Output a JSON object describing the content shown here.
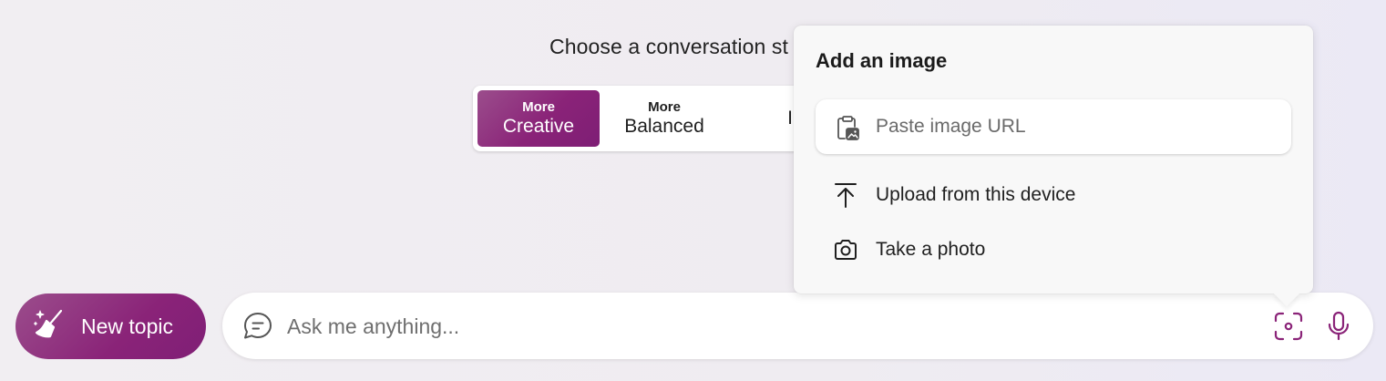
{
  "conversation_style": {
    "heading": "Choose a conversation st",
    "options": [
      {
        "top": "More",
        "main": "Creative",
        "active": true
      },
      {
        "top": "More",
        "main": "Balanced",
        "active": false
      },
      {
        "top": "",
        "main": "I",
        "active": false
      }
    ]
  },
  "new_topic": {
    "label": "New topic",
    "icon": "broom-sparkle-icon"
  },
  "input_bar": {
    "placeholder": "Ask me anything...",
    "icons": [
      "chat-bubble-icon",
      "image-search-icon",
      "microphone-icon"
    ]
  },
  "popover": {
    "title": "Add an image",
    "url_placeholder": "Paste image URL",
    "items": [
      {
        "label": "Upload from this device",
        "icon": "upload-icon"
      },
      {
        "label": "Take a photo",
        "icon": "camera-icon"
      }
    ]
  },
  "colors": {
    "accent": "#8a2378",
    "background": "#f0edf2",
    "popover_bg": "#f8f8f8"
  }
}
